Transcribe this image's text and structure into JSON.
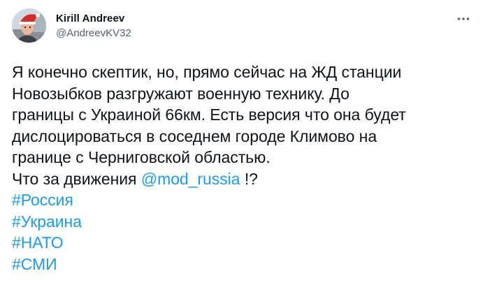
{
  "author": {
    "display_name": "Kirill Andreev",
    "handle": "@AndreevKV32",
    "avatar_icon": "avatar-photo-santa-hat"
  },
  "menu": {
    "icon": "more-horizontal-icon"
  },
  "tweet": {
    "lines": [
      "Я конечно скептик, но, прямо сейчас на ЖД станции",
      "Новозыбков разгружают военную технику. До",
      "границы с Украиной 66км. Есть версия что она будет",
      "дислоцироваться в соседнем городе Климово на",
      "границе с Черниговской областью."
    ],
    "question_prefix": "Что за движения",
    "mention": "@mod_russia",
    "question_suffix": "!?",
    "hashtags": [
      "#Россия",
      "#Украина",
      "#НАТО",
      "#СМИ"
    ]
  },
  "colors": {
    "text": "#0f1419",
    "secondary": "#536471",
    "link": "#1d9bf0",
    "background": "#ffffff"
  }
}
